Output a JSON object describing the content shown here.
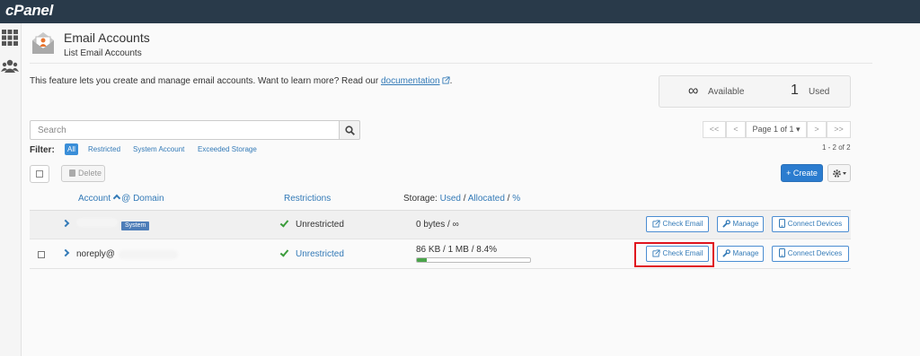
{
  "app": {
    "logo": "cPanel"
  },
  "sidebar": {
    "icons": [
      "grid-icon",
      "users-icon"
    ]
  },
  "header": {
    "title": "Email Accounts",
    "subtitle": "List Email Accounts"
  },
  "intro": {
    "text": "This feature lets you create and manage email accounts. Want to learn more? Read our ",
    "link": "documentation",
    "suffix": "."
  },
  "stats": {
    "available_symbol": "∞",
    "available_label": "Available",
    "used_count": "1",
    "used_label": "Used"
  },
  "search": {
    "placeholder": "Search"
  },
  "pagination": {
    "first": "<<",
    "prev": "<",
    "page": "Page 1 of 1 ▾",
    "next": ">",
    "last": ">>",
    "count": "1 - 2 of 2"
  },
  "filter": {
    "label": "Filter:",
    "options": [
      "All",
      "Restricted",
      "System Account",
      "Exceeded Storage"
    ],
    "active": "All"
  },
  "toolbar": {
    "delete": "Delete",
    "create": "+ Create"
  },
  "table": {
    "headers": {
      "account": "Account",
      "at_domain": "@ Domain",
      "restrictions": "Restrictions",
      "storage_label": "Storage:",
      "used": "Used",
      "sep1": "/",
      "allocated": "Allocated",
      "sep2": "/",
      "percent": "%"
    },
    "rows": [
      {
        "account": "",
        "badge": "System",
        "restriction": "Unrestricted",
        "storage": "0 bytes / ∞",
        "usage_percent": 0
      },
      {
        "account": "noreply@",
        "restriction": "Unrestricted",
        "storage": "86 KB / 1 MB / 8.4%",
        "usage_percent": 8.4
      }
    ],
    "actions": {
      "check_email": "Check Email",
      "manage": "Manage",
      "connect": "Connect Devices"
    }
  },
  "colors": {
    "topbar": "#293a4a",
    "accent": "#337ab7",
    "highlight": "#e0141e",
    "success": "#3b9c3b"
  }
}
